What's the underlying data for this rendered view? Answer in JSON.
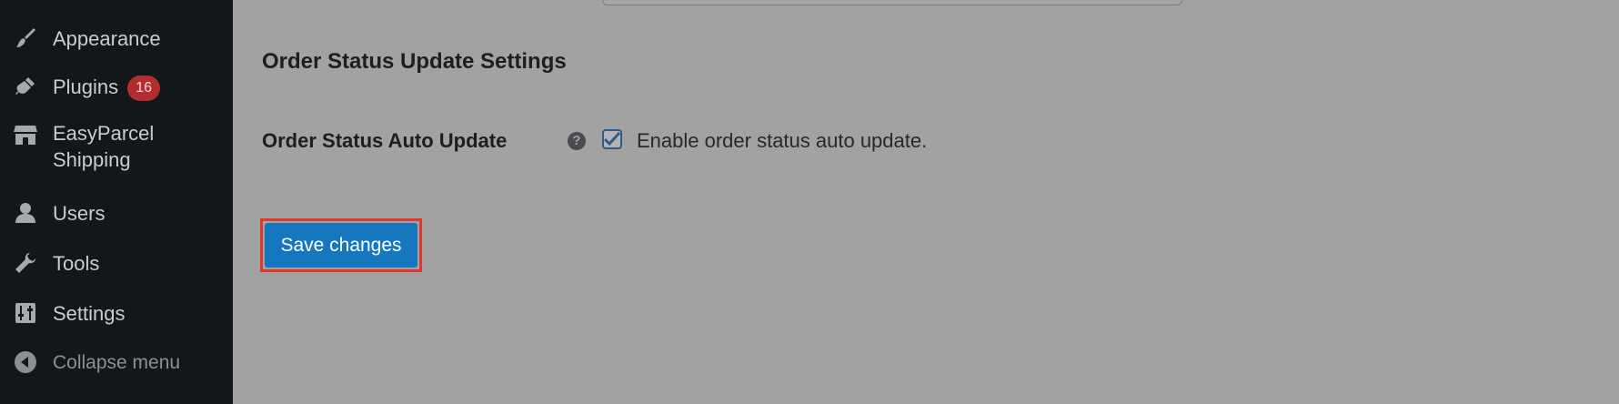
{
  "sidebar": {
    "items": [
      {
        "label": "Appearance",
        "icon": "paintbrush-icon"
      },
      {
        "label": "Plugins",
        "icon": "plugin-icon",
        "badge": "16"
      },
      {
        "label": "EasyParcel",
        "label_line2": "Shipping",
        "icon": "store-icon"
      },
      {
        "label": "Users",
        "icon": "user-icon"
      },
      {
        "label": "Tools",
        "icon": "wrench-icon"
      },
      {
        "label": "Settings",
        "icon": "settings-icon"
      }
    ],
    "collapse_label": "Collapse menu"
  },
  "main": {
    "section_title": "Order Status Update Settings",
    "auto_update": {
      "label": "Order Status Auto Update",
      "help_glyph": "?",
      "checkbox_label": "Enable order status auto update.",
      "checked": true
    },
    "save_label": "Save changes"
  },
  "colors": {
    "sidebar_bg": "#13171b",
    "content_bg": "#a2a2a2",
    "button_bg": "#1577bd",
    "badge_bg": "#b32d2e",
    "highlight": "#e0382c"
  }
}
